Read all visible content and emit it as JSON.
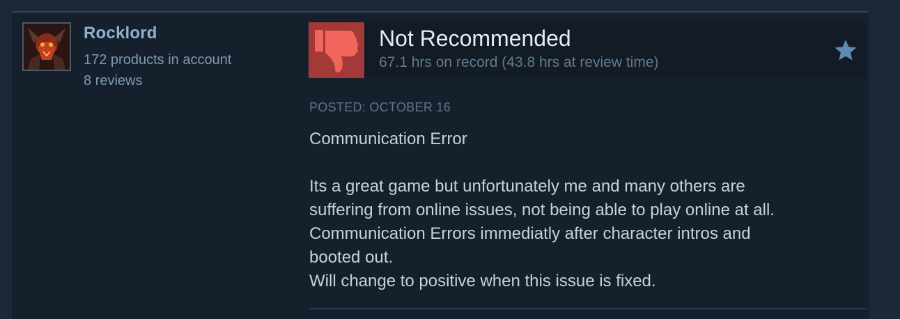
{
  "reviewer": {
    "name": "Rocklord",
    "products": "172 products in account",
    "reviews": "8 reviews"
  },
  "vote": {
    "title": "Not Recommended",
    "hours": "67.1 hrs on record (43.8 hrs at review time)",
    "icon": "thumbs-down-icon",
    "accent_color": "#a33a37"
  },
  "review": {
    "posted": "POSTED: OCTOBER 16",
    "title": "Communication Error",
    "lines": [
      "Its a great game but unfortunately me and many others are",
      "suffering from online issues, not being able to play online at all.",
      "Communication Errors immediatly after character intros and",
      "booted out.",
      "Will change to positive when this issue is fixed."
    ]
  },
  "colors": {
    "page_bg": "#1b2838",
    "card_bg": "#16202d",
    "name_color": "#8bb3cf",
    "star_color": "#5c8db0"
  }
}
